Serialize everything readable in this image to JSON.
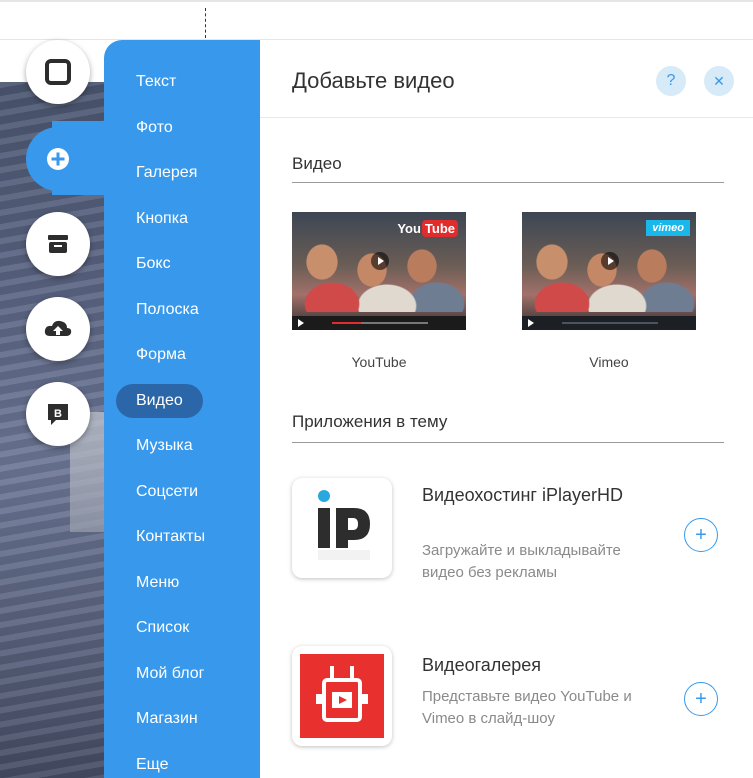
{
  "rail": {
    "items": [
      {
        "name": "background-icon",
        "active": false
      },
      {
        "name": "add-icon",
        "active": true
      },
      {
        "name": "store-icon",
        "active": false
      },
      {
        "name": "upload-icon",
        "active": false
      },
      {
        "name": "blog-icon",
        "active": false,
        "glyph": "B"
      }
    ]
  },
  "menu": {
    "items": [
      {
        "label": "Текст"
      },
      {
        "label": "Фото"
      },
      {
        "label": "Галерея"
      },
      {
        "label": "Кнопка"
      },
      {
        "label": "Бокс"
      },
      {
        "label": "Полоска"
      },
      {
        "label": "Форма"
      },
      {
        "label": "Видео"
      },
      {
        "label": "Музыка"
      },
      {
        "label": "Соцсети"
      },
      {
        "label": "Контакты"
      },
      {
        "label": "Меню"
      },
      {
        "label": "Список"
      },
      {
        "label": "Мой блог"
      },
      {
        "label": "Магазин"
      },
      {
        "label": "Еще"
      }
    ],
    "selected": "Видео"
  },
  "panel": {
    "title": "Добавьте видео",
    "help_glyph": "?",
    "close_glyph": "✕",
    "video_section": {
      "title": "Видео",
      "items": [
        {
          "label": "YouTube",
          "logo": "You",
          "logo_tube": "Tube",
          "progress": 0.3
        },
        {
          "label": "Vimeo",
          "logo": "vimeo",
          "progress": 0
        }
      ]
    },
    "apps_section": {
      "title": "Приложения в тему",
      "items": [
        {
          "name": "Видеохостинг iPlayerHD",
          "description": "Загружайте и выкладывайте видео без рекламы",
          "icon": "iplayerhd-logo-icon",
          "add_glyph": "+"
        },
        {
          "name": "Видеогалерея",
          "description": "Представьте видео YouTube и Vimeo в слайд-шоу",
          "icon": "video-gallery-logo-icon",
          "add_glyph": "+"
        }
      ]
    }
  },
  "colors": {
    "accent": "#3899ec",
    "menu_selected": "#2b67a8",
    "youtube_red": "#e02c2c",
    "vimeo_blue": "#1ab7ea",
    "gallery_red": "#e8312f"
  }
}
